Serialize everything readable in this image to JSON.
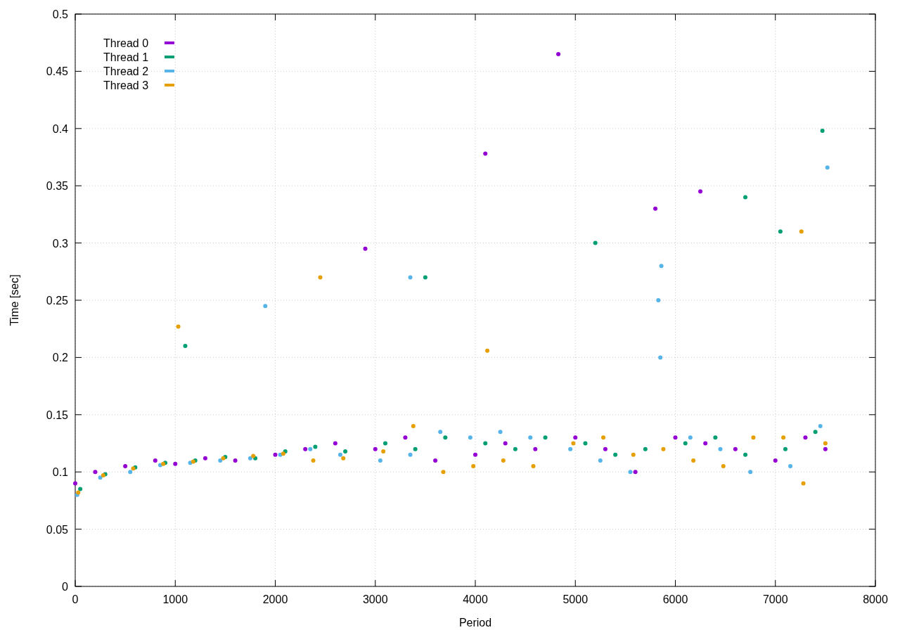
{
  "chart_data": {
    "type": "scatter",
    "grid": true,
    "legend": "upper left",
    "xlabel": "Period",
    "ylabel": "Time [sec]",
    "xlim": [
      0,
      8000
    ],
    "ylim": [
      0,
      0.5
    ],
    "xticks": [
      {
        "value": 0,
        "label": "0"
      },
      {
        "value": 1000,
        "label": "1000"
      },
      {
        "value": 2000,
        "label": "2000"
      },
      {
        "value": 3000,
        "label": "3000"
      },
      {
        "value": 4000,
        "label": "4000"
      },
      {
        "value": 5000,
        "label": "5000"
      },
      {
        "value": 6000,
        "label": "6000"
      },
      {
        "value": 7000,
        "label": "7000"
      },
      {
        "value": 8000,
        "label": "8000"
      }
    ],
    "yticks": [
      {
        "value": 0,
        "label": "0"
      },
      {
        "value": 0.05,
        "label": "0.05"
      },
      {
        "value": 0.1,
        "label": "0.1"
      },
      {
        "value": 0.15,
        "label": "0.15"
      },
      {
        "value": 0.2,
        "label": "0.2"
      },
      {
        "value": 0.25,
        "label": "0.25"
      },
      {
        "value": 0.3,
        "label": "0.3"
      },
      {
        "value": 0.35,
        "label": "0.35"
      },
      {
        "value": 0.4,
        "label": "0.4"
      },
      {
        "value": 0.45,
        "label": "0.45"
      },
      {
        "value": 0.5,
        "label": "0.5"
      }
    ],
    "series": [
      {
        "name": "Thread 0",
        "color": "#9400d3",
        "x": [
          0,
          200,
          500,
          800,
          1000,
          1300,
          1600,
          2000,
          2300,
          2600,
          3000,
          3300,
          3600,
          4000,
          4300,
          4600,
          5000,
          5300,
          5600,
          6000,
          6300,
          6600,
          7000,
          7300,
          7500,
          4830,
          4100,
          6250,
          5800,
          2900
        ],
        "values": [
          0.09,
          0.1,
          0.105,
          0.11,
          0.107,
          0.112,
          0.11,
          0.115,
          0.12,
          0.125,
          0.12,
          0.13,
          0.11,
          0.115,
          0.125,
          0.12,
          0.13,
          0.12,
          0.1,
          0.13,
          0.125,
          0.12,
          0.11,
          0.13,
          0.12,
          0.465,
          0.378,
          0.345,
          0.33,
          0.295
        ]
      },
      {
        "name": "Thread 1",
        "color": "#009e73",
        "x": [
          50,
          300,
          600,
          900,
          1200,
          1500,
          1800,
          2100,
          2400,
          2700,
          3100,
          3400,
          3700,
          4100,
          4400,
          4700,
          5100,
          5400,
          5700,
          6100,
          6400,
          6700,
          7100,
          7400,
          7470,
          1100,
          3500,
          6700,
          7050,
          5200
        ],
        "values": [
          0.085,
          0.098,
          0.104,
          0.108,
          0.11,
          0.113,
          0.112,
          0.118,
          0.122,
          0.118,
          0.125,
          0.12,
          0.13,
          0.125,
          0.12,
          0.13,
          0.125,
          0.115,
          0.12,
          0.125,
          0.13,
          0.115,
          0.12,
          0.135,
          0.398,
          0.21,
          0.27,
          0.34,
          0.31,
          0.3
        ]
      },
      {
        "name": "Thread 2",
        "color": "#56b4e9",
        "x": [
          20,
          250,
          550,
          850,
          1150,
          1450,
          1750,
          2050,
          2350,
          2650,
          3050,
          3350,
          3650,
          3950,
          4250,
          4550,
          4950,
          5250,
          5550,
          5830,
          5850,
          6150,
          6450,
          6750,
          7150,
          7450,
          7520,
          5860,
          3350,
          1900
        ],
        "values": [
          0.08,
          0.095,
          0.1,
          0.106,
          0.108,
          0.11,
          0.112,
          0.115,
          0.12,
          0.115,
          0.11,
          0.115,
          0.135,
          0.13,
          0.135,
          0.13,
          0.12,
          0.11,
          0.1,
          0.25,
          0.2,
          0.13,
          0.12,
          0.1,
          0.105,
          0.14,
          0.366,
          0.28,
          0.27,
          0.245
        ]
      },
      {
        "name": "Thread 3",
        "color": "#e69f00",
        "x": [
          30,
          280,
          580,
          880,
          1180,
          1480,
          1780,
          2080,
          2380,
          2680,
          3080,
          3380,
          3680,
          3980,
          4280,
          4580,
          4980,
          5280,
          5580,
          5880,
          6180,
          6480,
          6780,
          7080,
          7280,
          7500,
          1030,
          4120,
          7260,
          2450
        ],
        "values": [
          0.082,
          0.097,
          0.103,
          0.107,
          0.109,
          0.112,
          0.114,
          0.116,
          0.11,
          0.112,
          0.118,
          0.14,
          0.1,
          0.105,
          0.11,
          0.105,
          0.125,
          0.13,
          0.115,
          0.12,
          0.11,
          0.105,
          0.13,
          0.13,
          0.09,
          0.125,
          0.227,
          0.206,
          0.31,
          0.27
        ]
      }
    ]
  }
}
